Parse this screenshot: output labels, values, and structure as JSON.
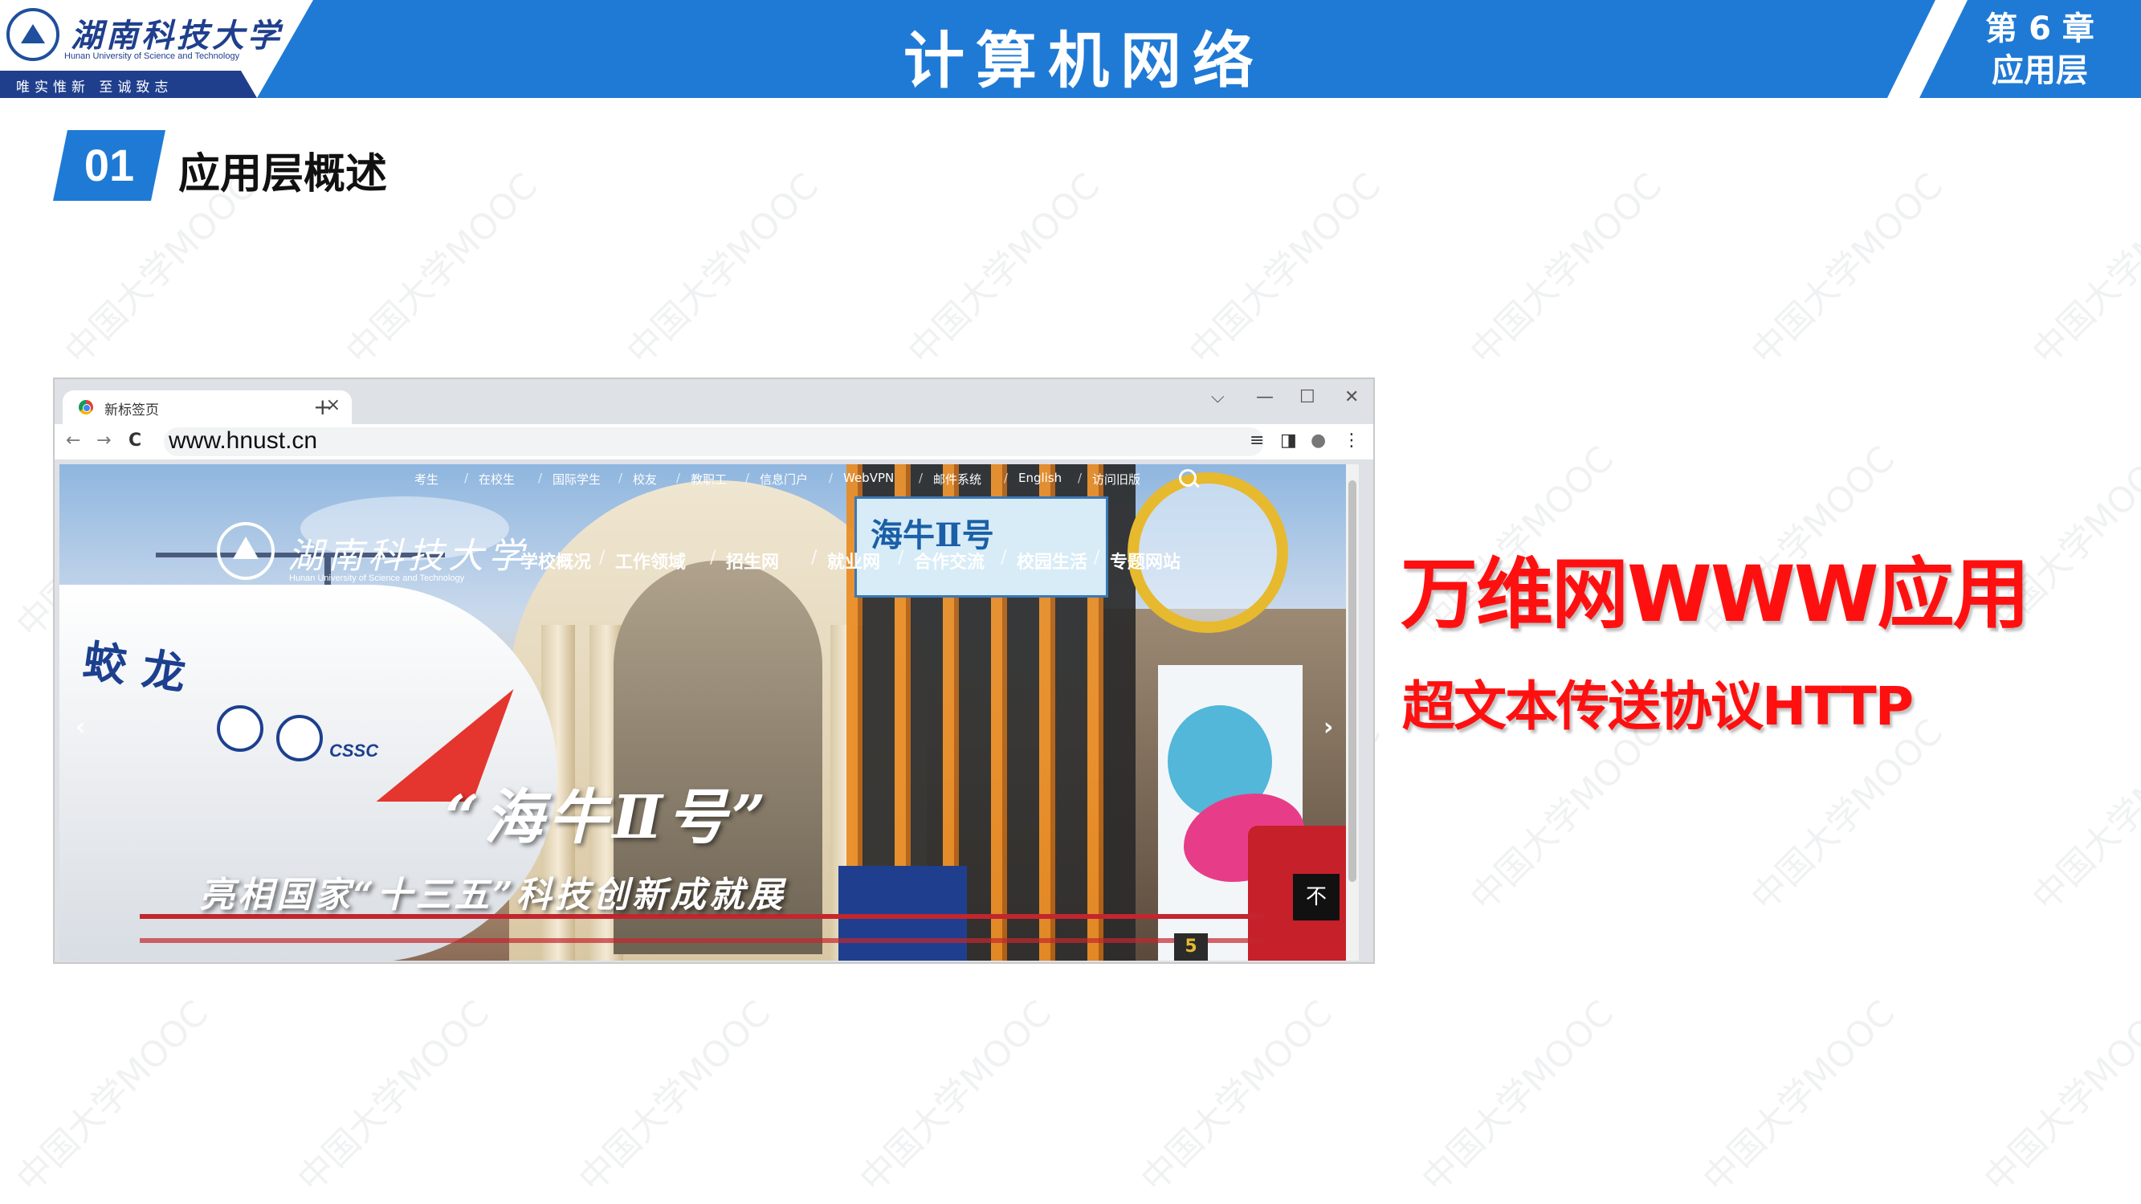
{
  "header": {
    "university_name": "湖南科技大学",
    "university_name_en": "Hunan University of Science and Technology",
    "motto": "唯实惟新   至诚致志",
    "course_title": "计算机网络",
    "chapter_line1": "第 6 章",
    "chapter_line2": "应用层",
    "color_banner": "#1f7ad6"
  },
  "section": {
    "number": "01",
    "title": "应用层概述"
  },
  "browser": {
    "tab_title": "新标签页",
    "tab_close": "×",
    "new_tab": "+",
    "url": "www.hnust.cn",
    "window_controls": [
      "⌵",
      "—",
      "☐",
      "✕"
    ],
    "nav_icons": [
      "←",
      "→",
      "C"
    ],
    "toolbar_icons": [
      "≡",
      "◨",
      "●",
      "⋮"
    ]
  },
  "website": {
    "top_nav": [
      "考生",
      "在校生",
      "国际学生",
      "校友",
      "教职工",
      "信息门户",
      "WebVPN",
      "邮件系统",
      "English",
      "访问旧版"
    ],
    "logo_text": "湖南科技大学",
    "logo_text_en": "Hunan University of Science and Technology",
    "main_nav": [
      "学校概况",
      "工作领域",
      "招生网",
      "就业网",
      "合作交流",
      "校园生活",
      "专题网站"
    ],
    "tower_sign": "海牛Ⅱ号",
    "submarine_name": "蛟龙",
    "submarine_badge": "CSSC",
    "headline": "“海牛Ⅱ号”",
    "subheadline": "亮相国家“十三五”科技创新成就展",
    "prev_arrow": "‹",
    "next_arrow": "›",
    "back_to_top": "不",
    "slide_number": "5"
  },
  "content": {
    "heading": "万维网WWW应用",
    "subheading": "超文本传送协议HTTP",
    "accent_color": "#ff1010"
  },
  "watermark": "中国大学MOOC"
}
